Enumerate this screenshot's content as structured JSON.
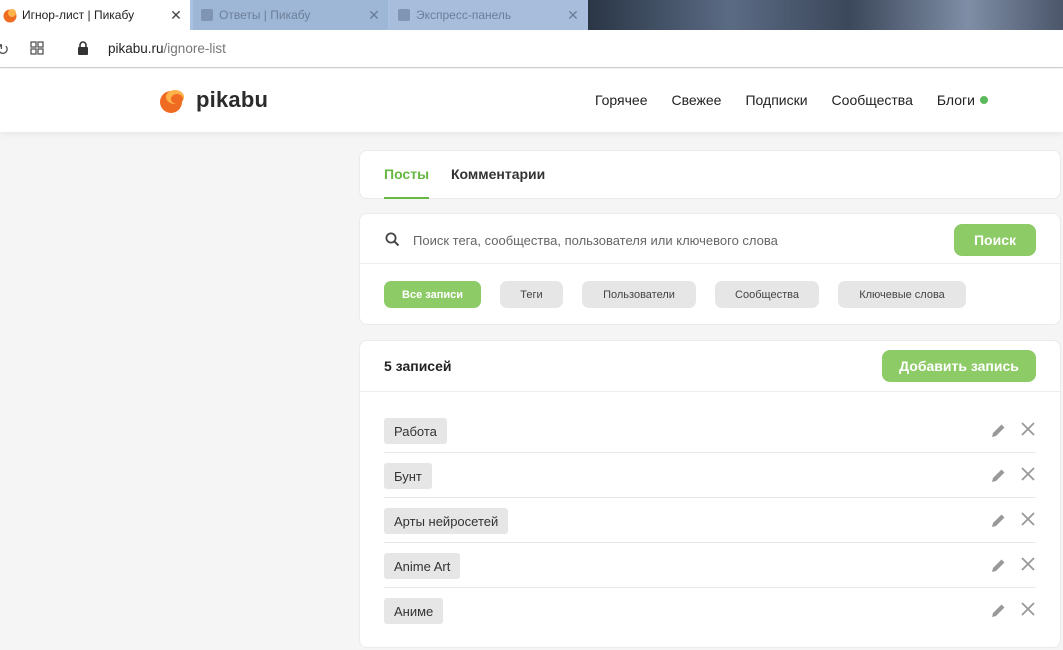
{
  "browser": {
    "tabs": [
      {
        "title": "Игнор-лист | Пикабу",
        "active": true
      },
      {
        "title": "Ответы | Пикабу",
        "active": false
      },
      {
        "title": "Экспресс-панель",
        "active": false
      }
    ],
    "url_domain": "pikabu.ru",
    "url_path": "/ignore-list"
  },
  "header": {
    "logo_text": "pikabu",
    "nav": [
      "Горячее",
      "Свежее",
      "Подписки",
      "Сообщества",
      "Блоги"
    ],
    "blogs_dot_color": "#5cb85c"
  },
  "page_tabs": {
    "posts": "Посты",
    "comments": "Комментарии",
    "active": "posts"
  },
  "search": {
    "placeholder": "Поиск тега, сообщества, пользователя или ключевого слова",
    "button": "Поиск"
  },
  "filters": [
    {
      "label": "Все записи",
      "active": true
    },
    {
      "label": "Теги",
      "active": false
    },
    {
      "label": "Пользователи",
      "active": false
    },
    {
      "label": "Сообщества",
      "active": false
    },
    {
      "label": "Ключевые слова",
      "active": false
    }
  ],
  "list": {
    "count_label": "5 записей",
    "add_button": "Добавить запись",
    "items": [
      "Работа",
      "Бунт",
      "Арты нейросетей",
      "Anime Art",
      "Аниме"
    ]
  },
  "colors": {
    "accent_green": "#67b843",
    "button_green": "#8dcb67",
    "logo_orange": "#f06b22"
  },
  "icons": {
    "row_edit": "pencil-icon",
    "row_delete": "close-icon",
    "search": "search-icon"
  }
}
